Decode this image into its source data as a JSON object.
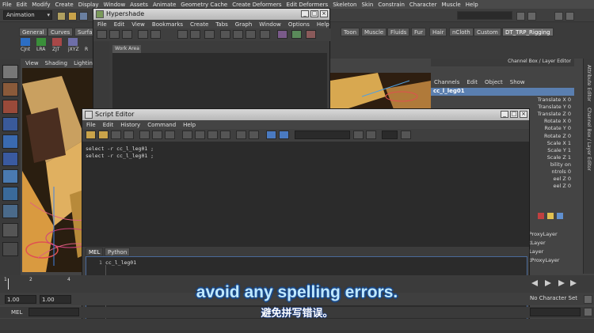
{
  "app": {
    "main_menu": [
      "File",
      "Edit",
      "Modify",
      "Create",
      "Display",
      "Window",
      "Assets",
      "Animate",
      "Geometry Cache",
      "Create Deformers",
      "Edit Deformers",
      "Skeleton",
      "Skin",
      "Constrain",
      "Character",
      "Muscle",
      "Help"
    ],
    "mode_dropdown": "Animation"
  },
  "shelf": {
    "tabs_left": [
      "General",
      "Curves",
      "Surfa"
    ],
    "tabs_right": [
      "Toon",
      "Muscle",
      "Fluids",
      "Fur",
      "Hair",
      "nCloth",
      "Custom",
      "DT_TRP_Rigging"
    ],
    "active_tab": "DT_TRP_Rigging",
    "buttons": [
      "CJnt",
      "LRA",
      "ZJT",
      "jXYZ",
      "R"
    ]
  },
  "viewport_menu": [
    "View",
    "Shading",
    "Lighting"
  ],
  "hypershade": {
    "title": "Hypershade",
    "menu": [
      "File",
      "Edit",
      "View",
      "Bookmarks",
      "Create",
      "Tabs",
      "Graph",
      "Window",
      "Options",
      "Help"
    ],
    "work_area_tab": "Work Area"
  },
  "channel_box": {
    "title": "Channel Box / Layer Editor",
    "menu": [
      "Channels",
      "Edit",
      "Object",
      "Show"
    ],
    "object_name": "cc_l_leg01",
    "attributes": [
      "Translate X 0",
      "Translate Y 0",
      "Translate Z 0",
      "Rotate X 0",
      "Rotate Y 0",
      "Rotate Z 0",
      "Scale X 1",
      "Scale Y 1",
      "Scale Z 1",
      "bility on",
      "ntrols 0",
      "eel Z 0",
      "eel Z 0"
    ],
    "layers": [
      "kProxyLayer",
      "otLayer",
      "dLayer",
      "otProxyLayer"
    ]
  },
  "side_tabs": [
    "Attribute Editor",
    "Channel Box / Layer Editor"
  ],
  "script_editor": {
    "title": "Script Editor",
    "menu": [
      "File",
      "Edit",
      "History",
      "Command",
      "Help"
    ],
    "history_lines": [
      "select -r cc_l_leg01 ;",
      "select -r cc_l_leg01 ;"
    ],
    "tabs": [
      "MEL",
      "Python"
    ],
    "active_tab": "MEL",
    "input_line_number": "1",
    "input_text": "cc_l_leg01"
  },
  "timeline": {
    "ticks": [
      "1",
      "2",
      "4"
    ],
    "start_field": "1.00",
    "start_field_2": "1.00",
    "character_set": "No Character Set"
  },
  "command_line": {
    "label": "MEL"
  },
  "subtitles": {
    "english": "avoid any spelling errors.",
    "chinese": "避免拼写错误。"
  }
}
